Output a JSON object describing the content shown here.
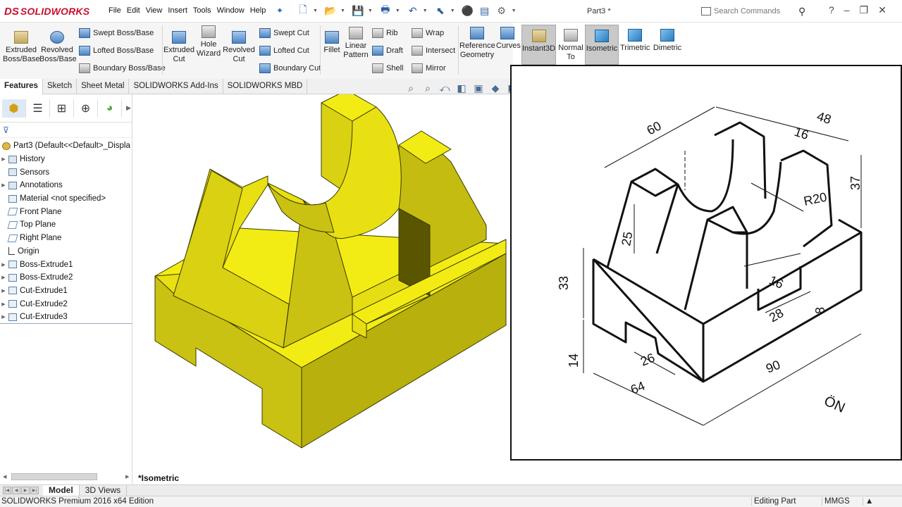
{
  "app": {
    "brand_ds": "DS",
    "brand_name": "SOLIDWORKS",
    "document_title": "Part3 *",
    "menu": [
      "File",
      "Edit",
      "View",
      "Insert",
      "Tools",
      "Window",
      "Help"
    ],
    "search_placeholder": "Search Commands",
    "help_label": "?"
  },
  "ribbon": {
    "extruded_boss": "Extruded Boss/Base",
    "revolved_boss": "Revolved Boss/Base",
    "swept_boss": "Swept Boss/Base",
    "lofted_boss": "Lofted Boss/Base",
    "boundary_boss": "Boundary Boss/Base",
    "extruded_cut": "Extruded Cut",
    "hole_wizard": "Hole Wizard",
    "revolved_cut": "Revolved Cut",
    "swept_cut": "Swept Cut",
    "lofted_cut": "Lofted Cut",
    "boundary_cut": "Boundary Cut",
    "fillet": "Fillet",
    "linear_pattern": "Linear Pattern",
    "rib": "Rib",
    "draft": "Draft",
    "shell": "Shell",
    "wrap": "Wrap",
    "intersect": "Intersect",
    "mirror": "Mirror",
    "reference_geometry": "Reference Geometry",
    "curves": "Curves",
    "instant3d": "Instant3D",
    "normal_to": "Normal To",
    "isometric": "Isometric",
    "trimetric": "Trimetric",
    "dimetric": "Dimetric"
  },
  "tabs": [
    "Features",
    "Sketch",
    "Sheet Metal",
    "SOLIDWORKS Add-Ins",
    "SOLIDWORKS MBD"
  ],
  "tree": {
    "root": "Part3  (Default<<Default>_Displa",
    "items": [
      {
        "label": "History",
        "expand": true
      },
      {
        "label": "Sensors",
        "expand": false
      },
      {
        "label": "Annotations",
        "expand": true
      },
      {
        "label": "Material <not specified>",
        "expand": false
      },
      {
        "label": "Front Plane",
        "expand": false
      },
      {
        "label": "Top Plane",
        "expand": false
      },
      {
        "label": "Right Plane",
        "expand": false
      },
      {
        "label": "Origin",
        "expand": false
      },
      {
        "label": "Boss-Extrude1",
        "expand": true
      },
      {
        "label": "Boss-Extrude2",
        "expand": true
      },
      {
        "label": "Cut-Extrude1",
        "expand": true
      },
      {
        "label": "Cut-Extrude2",
        "expand": true
      },
      {
        "label": "Cut-Extrude3",
        "expand": true
      }
    ]
  },
  "viewport": {
    "view_name": "*Isometric",
    "model_color": "#f2ec14"
  },
  "drawing": {
    "dimensions": [
      "60",
      "48",
      "16",
      "37",
      "R20",
      "25",
      "33",
      "16",
      "28",
      "8",
      "14",
      "26",
      "64",
      "90"
    ],
    "direction_label": "ÖN"
  },
  "bottom_tabs": [
    "Model",
    "3D Views"
  ],
  "status": {
    "edition": "SOLIDWORKS Premium 2016 x64 Edition",
    "mode": "Editing Part",
    "units": "MMGS"
  }
}
